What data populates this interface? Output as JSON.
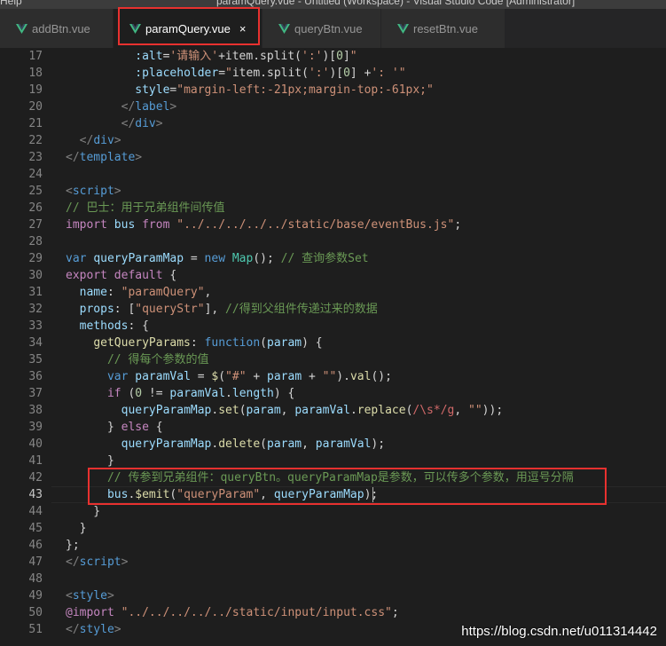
{
  "window": {
    "menu_label": "Help",
    "title": "paramQuery.vue - Untitled (Workspace) - Visual Studio Code [Administrator]"
  },
  "tabs": [
    {
      "label": "addBtn.vue",
      "active": false
    },
    {
      "label": "paramQuery.vue",
      "active": true,
      "close": "×"
    },
    {
      "label": "queryBtn.vue",
      "active": false
    },
    {
      "label": "resetBtn.vue",
      "active": false
    }
  ],
  "colors": {
    "vue_green": "#41b883",
    "highlight_red": "#e8312f",
    "editor_bg": "#1e1e1e"
  },
  "editor": {
    "current_line": 43,
    "lines": [
      {
        "n": "17",
        "parts": [
          [
            "t",
            "    "
          ],
          [
            "a",
            ":alt"
          ],
          [
            "t",
            "="
          ],
          [
            "s",
            "'请输入'"
          ],
          [
            "t",
            "+item.split("
          ],
          [
            "s",
            "':'"
          ],
          [
            "t",
            ")["
          ],
          [
            "num",
            "0"
          ],
          [
            "t",
            "]"
          ],
          [
            "s",
            "\""
          ]
        ]
      },
      {
        "n": "18",
        "parts": [
          [
            "t",
            "    "
          ],
          [
            "a",
            ":placeholder"
          ],
          [
            "t",
            "="
          ],
          [
            "s",
            "\""
          ],
          [
            "t",
            "item.split("
          ],
          [
            "s",
            "':'"
          ],
          [
            "t",
            ")["
          ],
          [
            "num",
            "0"
          ],
          [
            "t",
            "] +"
          ],
          [
            "s",
            "': '"
          ],
          [
            "s",
            "\""
          ]
        ]
      },
      {
        "n": "19",
        "parts": [
          [
            "t",
            "    "
          ],
          [
            "a",
            "style"
          ],
          [
            "t",
            "="
          ],
          [
            "s",
            "\"margin-left:-21px;margin-top:-61px;\""
          ]
        ]
      },
      {
        "n": "20",
        "parts": [
          [
            "t",
            "  "
          ],
          [
            "p",
            "</"
          ],
          [
            "g",
            "label"
          ],
          [
            "p",
            ">"
          ]
        ]
      },
      {
        "n": "21",
        "parts": [
          [
            "t",
            "  "
          ],
          [
            "p",
            "</"
          ],
          [
            "g",
            "div"
          ],
          [
            "p",
            ">"
          ]
        ]
      },
      {
        "n": "22",
        "parts": [
          [
            "p",
            "</"
          ],
          [
            "g",
            "div"
          ],
          [
            "p",
            ">"
          ]
        ]
      },
      {
        "n": "23",
        "parts": [
          [
            "p",
            "</"
          ],
          [
            "g",
            "template"
          ],
          [
            "p",
            ">"
          ]
        ]
      },
      {
        "n": "24",
        "parts": []
      },
      {
        "n": "25",
        "parts": [
          [
            "p",
            "<"
          ],
          [
            "g",
            "script"
          ],
          [
            "p",
            ">"
          ]
        ]
      },
      {
        "n": "26",
        "parts": [
          [
            "c",
            "// 巴士：用于兄弟组件间传值"
          ]
        ]
      },
      {
        "n": "27",
        "parts": [
          [
            "k",
            "import"
          ],
          [
            "t",
            " "
          ],
          [
            "v",
            "bus"
          ],
          [
            "t",
            " "
          ],
          [
            "k",
            "from"
          ],
          [
            "t",
            " "
          ],
          [
            "s",
            "\"../../../../../static/base/eventBus.js\""
          ],
          [
            "t",
            ";"
          ]
        ]
      },
      {
        "n": "28",
        "parts": []
      },
      {
        "n": "29",
        "parts": [
          [
            "kw",
            "var"
          ],
          [
            "t",
            " "
          ],
          [
            "v",
            "queryParamMap"
          ],
          [
            "t",
            " = "
          ],
          [
            "kw",
            "new"
          ],
          [
            "t",
            " "
          ],
          [
            "cl",
            "Map"
          ],
          [
            "t",
            "(); "
          ],
          [
            "c",
            "// 查询参数Set"
          ]
        ]
      },
      {
        "n": "30",
        "parts": [
          [
            "k",
            "export"
          ],
          [
            "t",
            " "
          ],
          [
            "k",
            "default"
          ],
          [
            "t",
            " {"
          ]
        ]
      },
      {
        "n": "31",
        "parts": [
          [
            "t",
            "  "
          ],
          [
            "v",
            "name"
          ],
          [
            "t",
            ": "
          ],
          [
            "s",
            "\"paramQuery\""
          ],
          [
            "t",
            ","
          ]
        ]
      },
      {
        "n": "32",
        "parts": [
          [
            "t",
            "  "
          ],
          [
            "v",
            "props"
          ],
          [
            "t",
            ": ["
          ],
          [
            "s",
            "\"queryStr\""
          ],
          [
            "t",
            "], "
          ],
          [
            "c",
            "//得到父组件传递过来的数据"
          ]
        ]
      },
      {
        "n": "33",
        "parts": [
          [
            "t",
            "  "
          ],
          [
            "v",
            "methods"
          ],
          [
            "t",
            ": {"
          ]
        ]
      },
      {
        "n": "34",
        "parts": [
          [
            "t",
            "    "
          ],
          [
            "f",
            "getQueryParams"
          ],
          [
            "t",
            ": "
          ],
          [
            "kw",
            "function"
          ],
          [
            "t",
            "("
          ],
          [
            "v",
            "param"
          ],
          [
            "t",
            ") {"
          ]
        ]
      },
      {
        "n": "35",
        "parts": [
          [
            "t",
            "      "
          ],
          [
            "c",
            "// 得每个参数的值"
          ]
        ]
      },
      {
        "n": "36",
        "parts": [
          [
            "t",
            "      "
          ],
          [
            "kw",
            "var"
          ],
          [
            "t",
            " "
          ],
          [
            "v",
            "paramVal"
          ],
          [
            "t",
            " = "
          ],
          [
            "f",
            "$"
          ],
          [
            "t",
            "("
          ],
          [
            "s",
            "\"#\""
          ],
          [
            "t",
            " + "
          ],
          [
            "v",
            "param"
          ],
          [
            "t",
            " + "
          ],
          [
            "s",
            "\"\""
          ],
          [
            "t",
            ")."
          ],
          [
            "f",
            "val"
          ],
          [
            "t",
            "();"
          ]
        ]
      },
      {
        "n": "37",
        "parts": [
          [
            "t",
            "      "
          ],
          [
            "k",
            "if"
          ],
          [
            "t",
            " ("
          ],
          [
            "num",
            "0"
          ],
          [
            "t",
            " != "
          ],
          [
            "v",
            "paramVal"
          ],
          [
            "t",
            "."
          ],
          [
            "v",
            "length"
          ],
          [
            "t",
            ") {"
          ]
        ]
      },
      {
        "n": "38",
        "parts": [
          [
            "t",
            "        "
          ],
          [
            "v",
            "queryParamMap"
          ],
          [
            "t",
            "."
          ],
          [
            "f",
            "set"
          ],
          [
            "t",
            "("
          ],
          [
            "v",
            "param"
          ],
          [
            "t",
            ", "
          ],
          [
            "v",
            "paramVal"
          ],
          [
            "t",
            "."
          ],
          [
            "f",
            "replace"
          ],
          [
            "t",
            "("
          ],
          [
            "re",
            "/\\s*/g"
          ],
          [
            "t",
            ", "
          ],
          [
            "s",
            "\"\""
          ],
          [
            "t",
            "));"
          ]
        ]
      },
      {
        "n": "39",
        "parts": [
          [
            "t",
            "      } "
          ],
          [
            "k",
            "else"
          ],
          [
            "t",
            " {"
          ]
        ]
      },
      {
        "n": "40",
        "parts": [
          [
            "t",
            "        "
          ],
          [
            "v",
            "queryParamMap"
          ],
          [
            "t",
            "."
          ],
          [
            "f",
            "delete"
          ],
          [
            "t",
            "("
          ],
          [
            "v",
            "param"
          ],
          [
            "t",
            ", "
          ],
          [
            "v",
            "paramVal"
          ],
          [
            "t",
            ");"
          ]
        ]
      },
      {
        "n": "41",
        "parts": [
          [
            "t",
            "      }"
          ]
        ]
      },
      {
        "n": "42",
        "parts": [
          [
            "t",
            "      "
          ],
          [
            "c",
            "// 传参到兄弟组件：queryBtn。queryParamMap是参数，可以传多个参数，用逗号分隔"
          ]
        ]
      },
      {
        "n": "43",
        "parts": [
          [
            "t",
            "      "
          ],
          [
            "v",
            "bus"
          ],
          [
            "t",
            "."
          ],
          [
            "f",
            "$emit"
          ],
          [
            "t",
            "("
          ],
          [
            "s",
            "\"queryParam\""
          ],
          [
            "t",
            ", "
          ],
          [
            "v",
            "queryParamMap"
          ],
          [
            "t",
            ");"
          ]
        ]
      },
      {
        "n": "44",
        "parts": [
          [
            "t",
            "    }"
          ]
        ]
      },
      {
        "n": "45",
        "parts": [
          [
            "t",
            "  }"
          ]
        ]
      },
      {
        "n": "46",
        "parts": [
          [
            "t",
            "};"
          ]
        ]
      },
      {
        "n": "47",
        "parts": [
          [
            "p",
            "</"
          ],
          [
            "g",
            "script"
          ],
          [
            "p",
            ">"
          ]
        ]
      },
      {
        "n": "48",
        "parts": []
      },
      {
        "n": "49",
        "parts": [
          [
            "p",
            "<"
          ],
          [
            "g",
            "style"
          ],
          [
            "p",
            ">"
          ]
        ]
      },
      {
        "n": "50",
        "parts": [
          [
            "ctl",
            "@import"
          ],
          [
            "t",
            " "
          ],
          [
            "s",
            "\"../../../../../static/input/input.css\""
          ],
          [
            "t",
            ";"
          ]
        ]
      },
      {
        "n": "51",
        "parts": [
          [
            "p",
            "</"
          ],
          [
            "g",
            "style"
          ],
          [
            "p",
            ">"
          ]
        ]
      }
    ]
  },
  "watermark": "https://blog.csdn.net/u011314442"
}
